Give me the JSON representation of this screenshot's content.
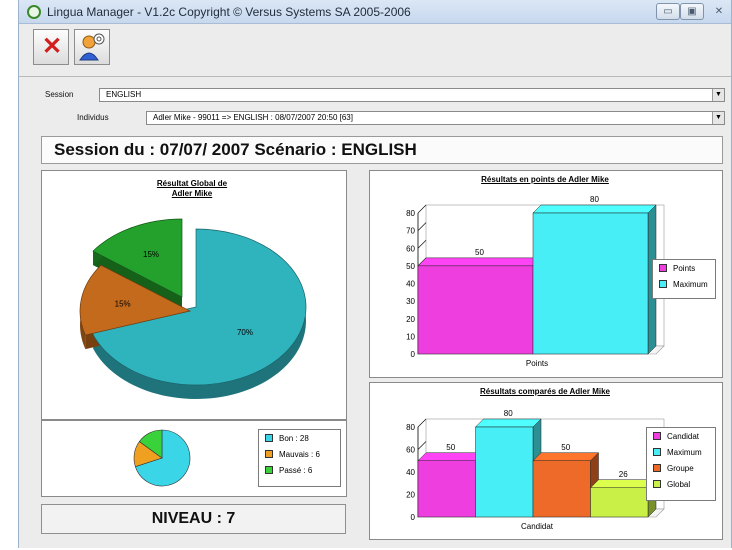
{
  "window": {
    "title": "Lingua Manager - V1.2c Copyright © Versus Systems SA 2005-2006",
    "min_label": "▭",
    "max_label": "▣",
    "close_label": "✕"
  },
  "toolbar": {
    "close_icon": "close-x-icon",
    "user_icon": "user-icon"
  },
  "form": {
    "session_label": "Session",
    "session_value": "ENGLISH",
    "individus_label": "Individus",
    "individus_value": "Adler Mike - 99011 => ENGLISH : 08/07/2007 20:50 [63]"
  },
  "session_header": "Session du : 07/07/ 2007 Scénario : ENGLISH",
  "global_panel": {
    "title_line1": "Résultat Global de",
    "title_line2": "Adler Mike",
    "legend": [
      {
        "label": "Bon : 28",
        "color": "#3ad6e8"
      },
      {
        "label": "Mauvais : 6",
        "color": "#f0a020"
      },
      {
        "label": "Passé : 6",
        "color": "#3ad23a"
      }
    ]
  },
  "niveau": "NIVEAU : 7",
  "points_panel": {
    "title": "Résultats en points de Adler Mike"
  },
  "compares_panel": {
    "title": "Résultats comparés de Adler Mike"
  },
  "chart_data": [
    {
      "type": "pie",
      "title": "Résultat Global de Adler Mike",
      "slices": [
        {
          "label": "Bon",
          "value": 28,
          "percent": "70%",
          "color": "#2fb3bd"
        },
        {
          "label": "Mauvais",
          "value": 6,
          "percent": "15%",
          "color": "#c46a1c"
        },
        {
          "label": "Passé",
          "value": 6,
          "percent": "15%",
          "color": "#23a12c"
        }
      ]
    },
    {
      "type": "bar",
      "title": "Résultats en points de Adler Mike",
      "categories": [
        "Points"
      ],
      "series": [
        {
          "name": "Points",
          "values": [
            50
          ],
          "color": "#ee3ee0"
        },
        {
          "name": "Maximum",
          "values": [
            80
          ],
          "color": "#48eef6"
        }
      ],
      "ylim": [
        0,
        80
      ],
      "yticks": [
        0,
        10,
        20,
        30,
        40,
        50,
        60,
        70,
        80
      ],
      "xlabel": "Points"
    },
    {
      "type": "bar",
      "title": "Résultats comparés de Adler Mike",
      "categories": [
        "Candidat"
      ],
      "series": [
        {
          "name": "Candidat",
          "values": [
            50
          ],
          "color": "#ee3ee0"
        },
        {
          "name": "Maximum",
          "values": [
            80
          ],
          "color": "#48eef6"
        },
        {
          "name": "Groupe",
          "values": [
            50
          ],
          "color": "#ee6a28"
        },
        {
          "name": "Global",
          "values": [
            26
          ],
          "color": "#c8f046"
        }
      ],
      "ylim": [
        0,
        80
      ],
      "yticks": [
        0,
        20,
        40,
        60,
        80
      ],
      "xlabel": "Candidat"
    }
  ]
}
